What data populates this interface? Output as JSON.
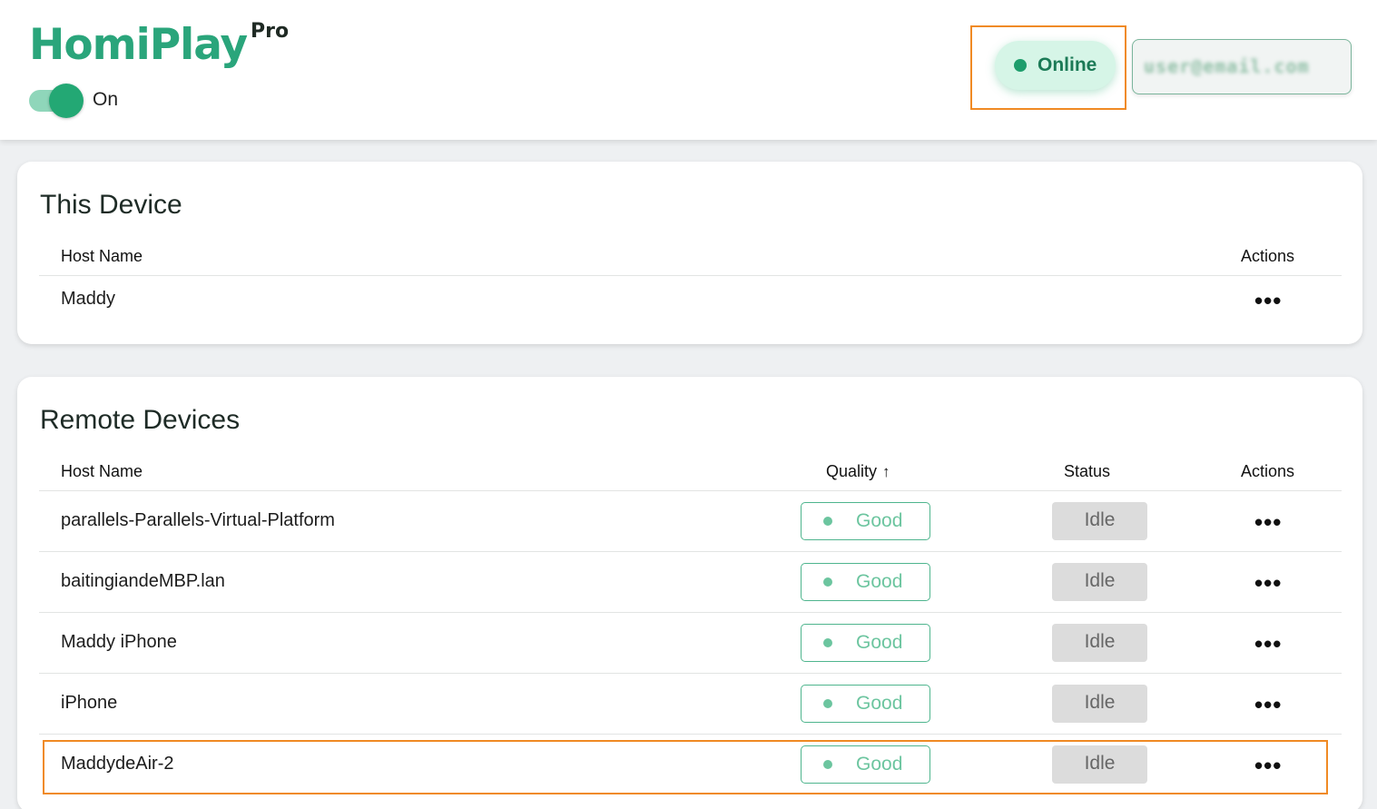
{
  "header": {
    "app_name": "HomiPlay",
    "tier": "Pro",
    "toggle_label": "On",
    "toggle_on": true,
    "connection_status": "Online",
    "account_email_blurred": "user@email.com"
  },
  "this_device": {
    "title": "This Device",
    "columns": {
      "host_name": "Host Name",
      "actions": "Actions"
    },
    "rows": [
      {
        "host_name": "Maddy",
        "actions_icon": "more-horizontal-icon"
      }
    ]
  },
  "remote_devices": {
    "title": "Remote Devices",
    "columns": {
      "host_name": "Host Name",
      "quality": "Quality",
      "quality_sort": "ascending",
      "status": "Status",
      "actions": "Actions"
    },
    "rows": [
      {
        "host_name": "parallels-Parallels-Virtual-Platform",
        "quality": "Good",
        "status": "Idle"
      },
      {
        "host_name": "baitingiandeMBP.lan",
        "quality": "Good",
        "status": "Idle"
      },
      {
        "host_name": "Maddy iPhone",
        "quality": "Good",
        "status": "Idle"
      },
      {
        "host_name": "iPhone",
        "quality": "Good",
        "status": "Idle"
      },
      {
        "host_name": "MaddydeAir-2",
        "quality": "Good",
        "status": "Idle"
      }
    ]
  },
  "colors": {
    "brand": "#2aa57b",
    "online_bg": "#d6f5e7",
    "quality_good": "#6cc59f",
    "highlight": "#f08a24",
    "status_idle_bg": "#dcdcdc"
  },
  "more_glyph": "•••",
  "sort_glyph": "↑"
}
